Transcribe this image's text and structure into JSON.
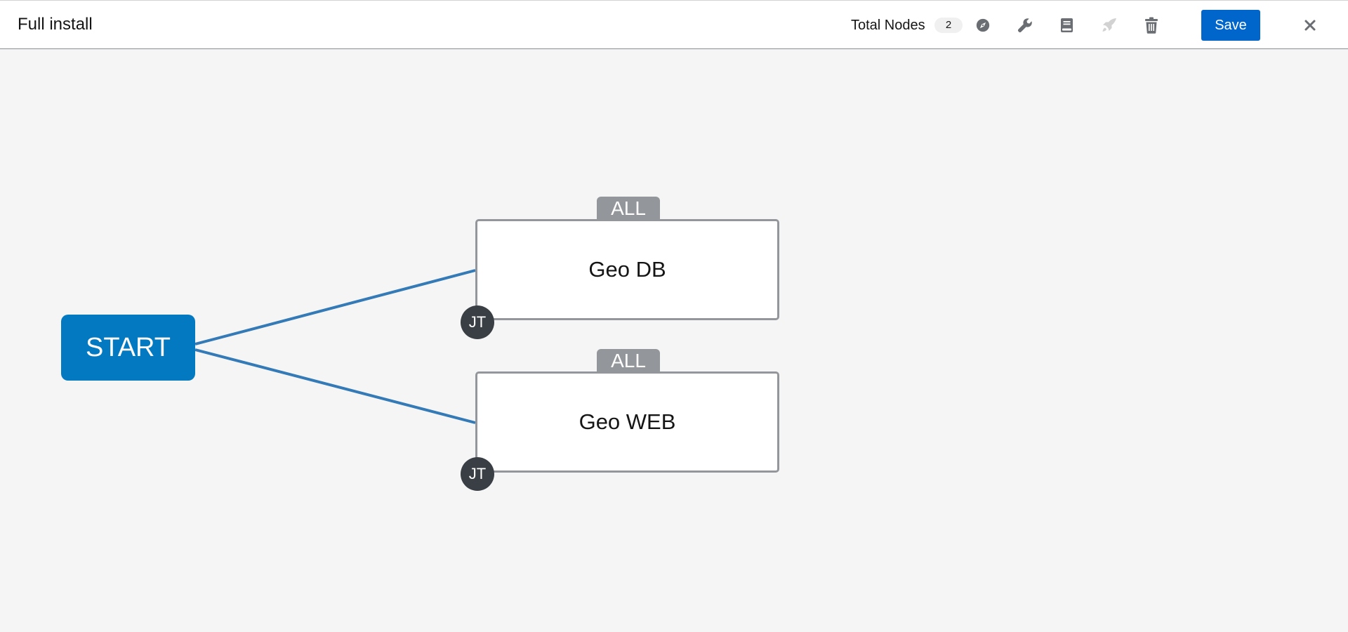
{
  "header": {
    "title": "Full install",
    "total_nodes_label": "Total Nodes",
    "total_nodes_count": "2",
    "save_label": "Save",
    "tools": [
      {
        "icon": "compass-icon",
        "enabled": true
      },
      {
        "icon": "wrench-icon",
        "enabled": true
      },
      {
        "icon": "book-icon",
        "enabled": true
      },
      {
        "icon": "rocket-icon",
        "enabled": false
      },
      {
        "icon": "trash-icon",
        "enabled": true
      }
    ],
    "close_icon": "close-icon"
  },
  "workflow": {
    "start_label": "START",
    "nodes": [
      {
        "name": "Geo DB",
        "edge_label": "ALL",
        "type_badge": "JT"
      },
      {
        "name": "Geo WEB",
        "edge_label": "ALL",
        "type_badge": "JT"
      }
    ]
  },
  "colors": {
    "brand_blue": "#0066cc",
    "start_node": "#0279c1",
    "link_line": "#337ab7",
    "node_border": "#93969a",
    "badge_dark": "#393f44",
    "icon_gray": "#6a6e73",
    "icon_disabled": "#d2d2d2",
    "canvas_bg": "#f5f5f5"
  }
}
